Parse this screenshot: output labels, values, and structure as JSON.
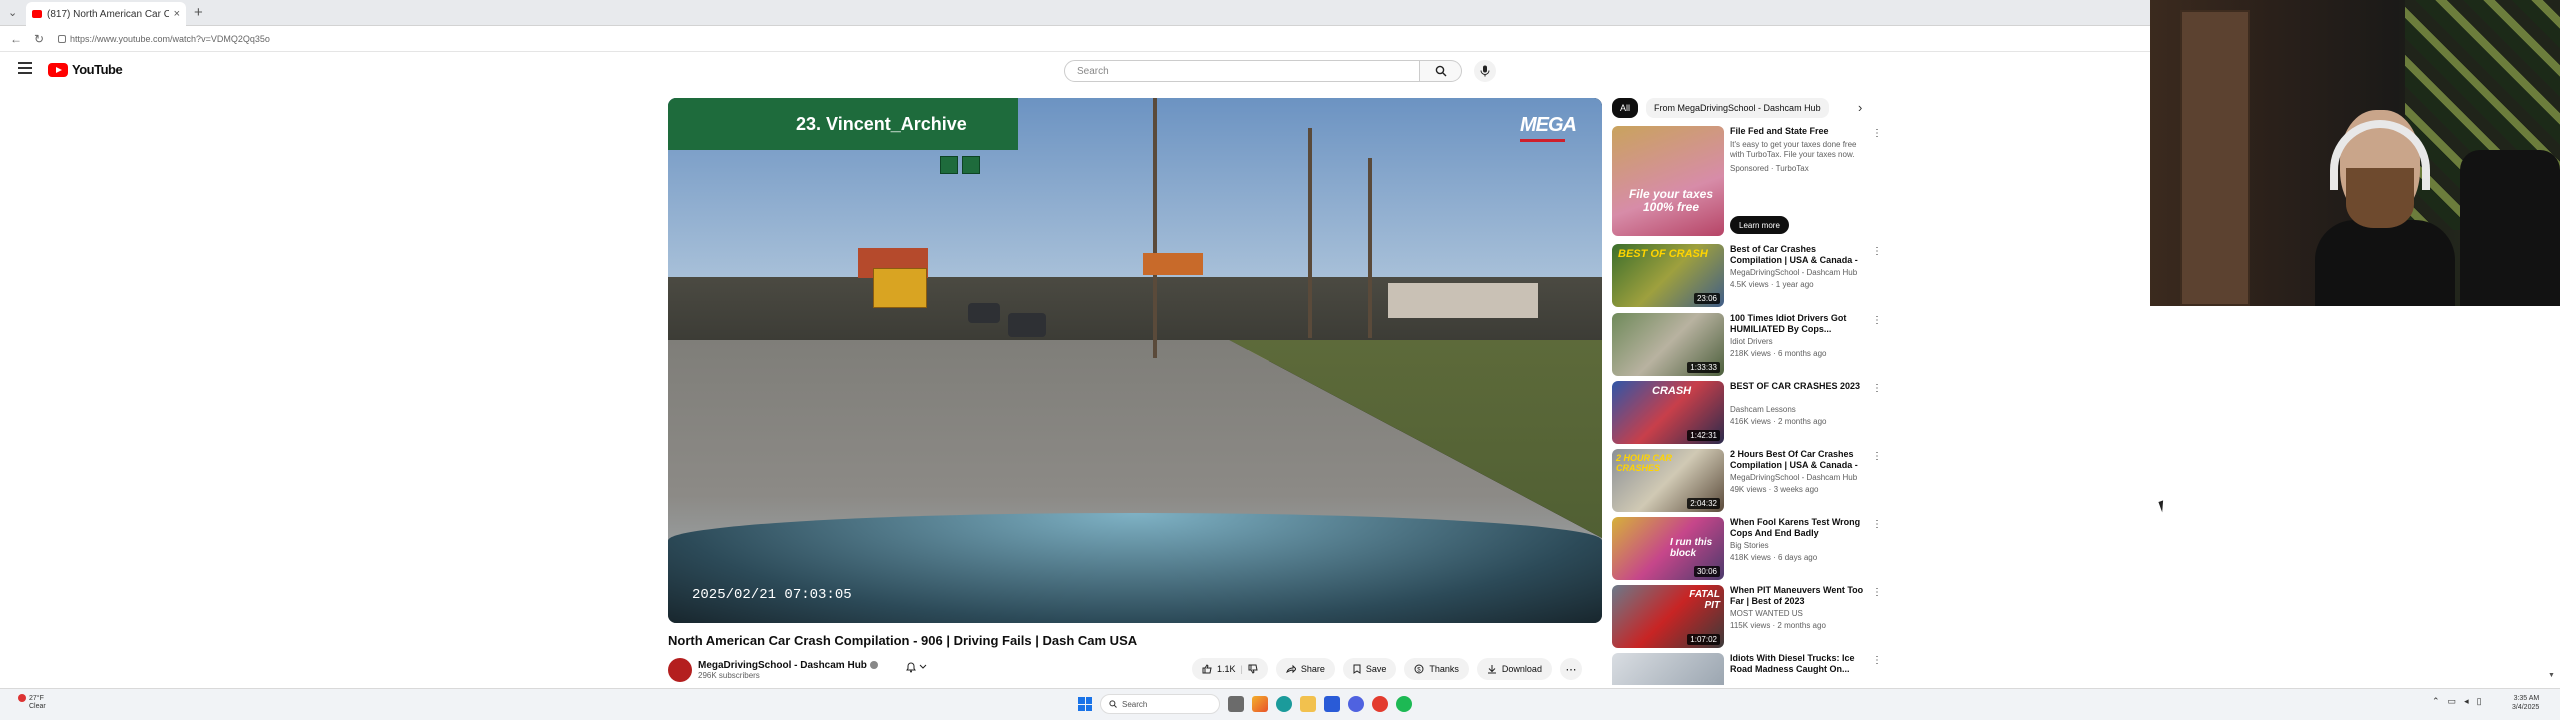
{
  "browser": {
    "tab_title": "(817) North American Car Crash C",
    "tab_close": "×",
    "new_tab": "+",
    "url": "https://www.youtube.com/watch?v=VDMQ2Qq35o"
  },
  "header": {
    "logo_text": "YouTube",
    "search_placeholder": "Search"
  },
  "video": {
    "overlay_banner": "23.  Vincent_Archive",
    "watermark": "MEGA",
    "timestamp": "2025/02/21  07:03:05",
    "title": "North American Car Crash Compilation - 906 | Driving Fails | Dash Cam USA",
    "channel_name": "MegaDrivingSchool - Dashcam Hub",
    "subscribers": "296K subscribers",
    "likes": "1.1K",
    "share_label": "Share",
    "save_label": "Save",
    "thanks_label": "Thanks",
    "download_label": "Download"
  },
  "sidebar": {
    "chips": [
      "All",
      "From MegaDrivingSchool - Dashcam Hub"
    ],
    "ad": {
      "title": "File Fed and State Free",
      "description": "It's easy to get your taxes done free with TurboTax. File your taxes now.",
      "sponsor": "Sponsored · TurboTax",
      "thumb_text": "File your taxes 100% free",
      "cta": "Learn more"
    },
    "items": [
      {
        "title": "Best of Car Crashes Compilation | USA & Canada - 1",
        "channel": "MegaDrivingSchool - Dashcam Hub",
        "meta": "4.5K views · 1 year ago",
        "duration": "23:06",
        "thumb_text": "BEST OF CRASH"
      },
      {
        "title": "100 Times Idiot Drivers Got HUMILIATED By Cops...",
        "channel": "Idiot Drivers",
        "meta": "218K views · 6 months ago",
        "duration": "1:33:33",
        "thumb_text": ""
      },
      {
        "title": "BEST OF CAR CRASHES 2023",
        "channel": "Dashcam Lessons",
        "meta": "416K views · 2 months ago",
        "duration": "1:42:31",
        "thumb_text": "CRASH"
      },
      {
        "title": "2 Hours Best Of Car Crashes Compilation | USA & Canada - 7",
        "channel": "MegaDrivingSchool - Dashcam Hub",
        "meta": "49K views · 3 weeks ago",
        "duration": "2:04:32",
        "thumb_text": "2 HOUR CAR CRASHES"
      },
      {
        "title": "When Fool Karens Test Wrong Cops And End Badly",
        "channel": "Big Stories",
        "meta": "418K views · 6 days ago",
        "duration": "30:06",
        "thumb_text": "I run this block"
      },
      {
        "title": "When PIT Maneuvers Went Too Far | Best of 2023",
        "channel": "MOST WANTED US",
        "meta": "115K views · 2 months ago",
        "duration": "1:07:02",
        "thumb_text": "FATAL PIT"
      },
      {
        "title": "Idiots With Diesel Trucks: Ice Road Madness Caught On...",
        "channel": "",
        "meta": "",
        "duration": "",
        "thumb_text": ""
      }
    ]
  },
  "taskbar": {
    "weather_temp": "27°F",
    "weather_desc": "Clear",
    "search_label": "Search",
    "time": "3:35 AM",
    "date": "3/4/2025"
  },
  "colors": {
    "youtube_red": "#ff0000",
    "banner_green": "#1e6b3c"
  },
  "icons": [
    "menu-icon",
    "search-icon",
    "mic-icon",
    "bell-icon",
    "like-icon",
    "dislike-icon",
    "share-icon",
    "save-icon",
    "thanks-icon",
    "download-icon",
    "more-icon",
    "kebab-icon",
    "windows-icon"
  ]
}
